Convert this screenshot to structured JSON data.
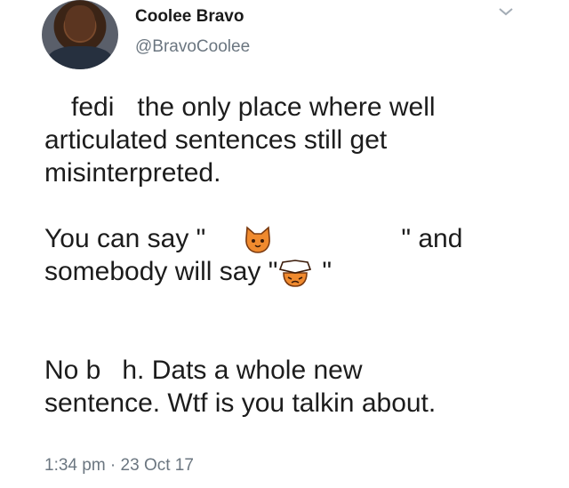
{
  "tweet": {
    "author_name": "Coolee Bravo",
    "author_handle": "@BravoCoolee",
    "lines": {
      "l1_a": "fedi",
      "l1_b": "the only place where well",
      "l2": "articulated sentences still get",
      "l3": "misinterpreted.",
      "l5_a": "You can say \"",
      "l5_b": "\" and",
      "l6_a": "somebody will say \"",
      "l6_b": "\"",
      "l8_a": "No b",
      "l8_b": "h. Dats a whole new",
      "l9": "sentence. Wtf is you talkin about."
    },
    "timestamp": "1:34 pm · 23 Oct 17",
    "icons": {
      "menu": "chevron-down-icon",
      "emoji_1": "cat-face-emoji",
      "emoji_2": "cat-face-emoji-with-hat"
    }
  }
}
